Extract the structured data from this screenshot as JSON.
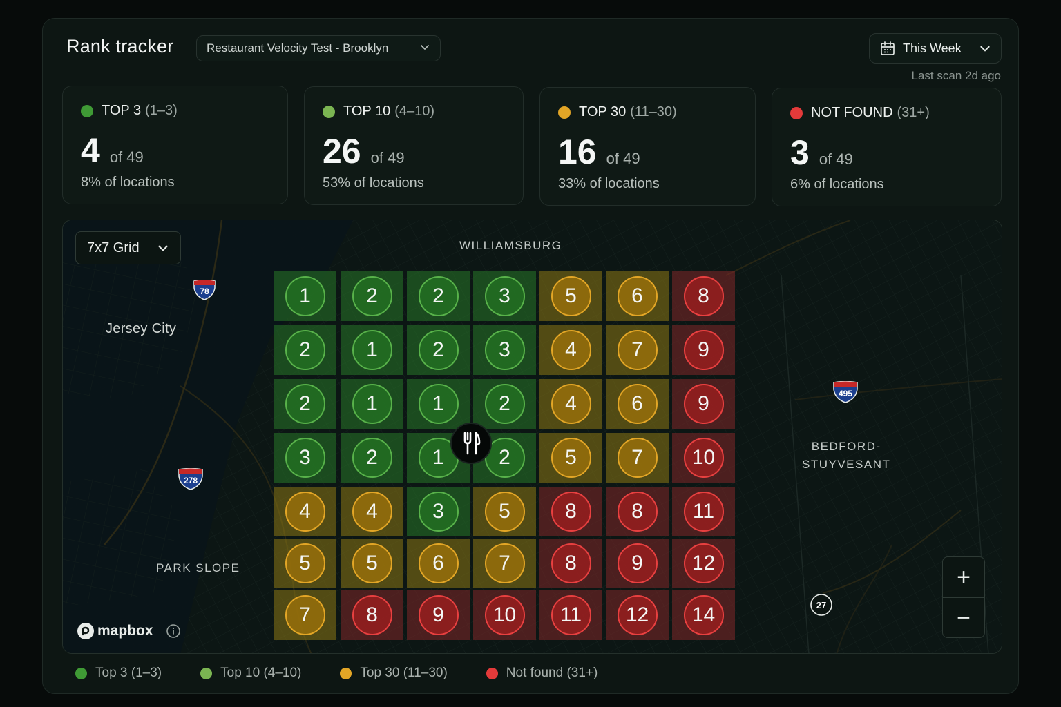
{
  "header": {
    "title": "Rank tracker",
    "project": "Restaurant Velocity Test - Brooklyn",
    "period": "This Week",
    "last_scan": "Last scan 2d ago"
  },
  "colors": {
    "top3": "#3f9a35",
    "top10": "#7bb552",
    "top30": "#e3a626",
    "not_found": "#e33a3a"
  },
  "stats": [
    {
      "label": "TOP 3",
      "range": "(1–3)",
      "value": "4",
      "of": "of 49",
      "pct": "8% of locations",
      "color": "#3f9a35"
    },
    {
      "label": "TOP 10",
      "range": "(4–10)",
      "value": "26",
      "of": "of 49",
      "pct": "53% of locations",
      "color": "#7bb552"
    },
    {
      "label": "TOP 30",
      "range": "(11–30)",
      "value": "16",
      "of": "of 49",
      "pct": "33% of locations",
      "color": "#e3a626"
    },
    {
      "label": "NOT FOUND",
      "range": "(31+)",
      "value": "3",
      "of": "of 49",
      "pct": "6% of locations",
      "color": "#e33a3a"
    }
  ],
  "map": {
    "grid_size": "7x7 Grid",
    "labels": {
      "williamsburg": "WILLIAMSBURG",
      "jersey_city": "Jersey City",
      "bedford_line1": "BEDFORD-",
      "bedford_line2": "STUYVESANT",
      "park_slope": "PARK SLOPE"
    },
    "shields": {
      "i78": "78",
      "i278": "278",
      "i495": "495",
      "r27": "27"
    },
    "attribution": "mapbox",
    "zoom_in": "+",
    "zoom_out": "−",
    "ranks": [
      [
        1,
        2,
        2,
        3,
        5,
        6,
        8
      ],
      [
        2,
        1,
        2,
        3,
        4,
        7,
        9
      ],
      [
        2,
        1,
        1,
        2,
        4,
        6,
        9
      ],
      [
        3,
        2,
        1,
        2,
        5,
        7,
        10
      ],
      [
        4,
        4,
        3,
        5,
        8,
        8,
        11
      ],
      [
        5,
        5,
        6,
        7,
        8,
        9,
        12
      ],
      [
        7,
        8,
        9,
        10,
        11,
        12,
        14
      ]
    ],
    "pin_icon": "restaurant-icon"
  },
  "legend": [
    {
      "label": "Top 3 (1–3)",
      "color": "#3f9a35"
    },
    {
      "label": "Top 10 (4–10)",
      "color": "#7bb552"
    },
    {
      "label": "Top 30 (11–30)",
      "color": "#e3a626"
    },
    {
      "label": "Not found (31+)",
      "color": "#e33a3a"
    }
  ]
}
